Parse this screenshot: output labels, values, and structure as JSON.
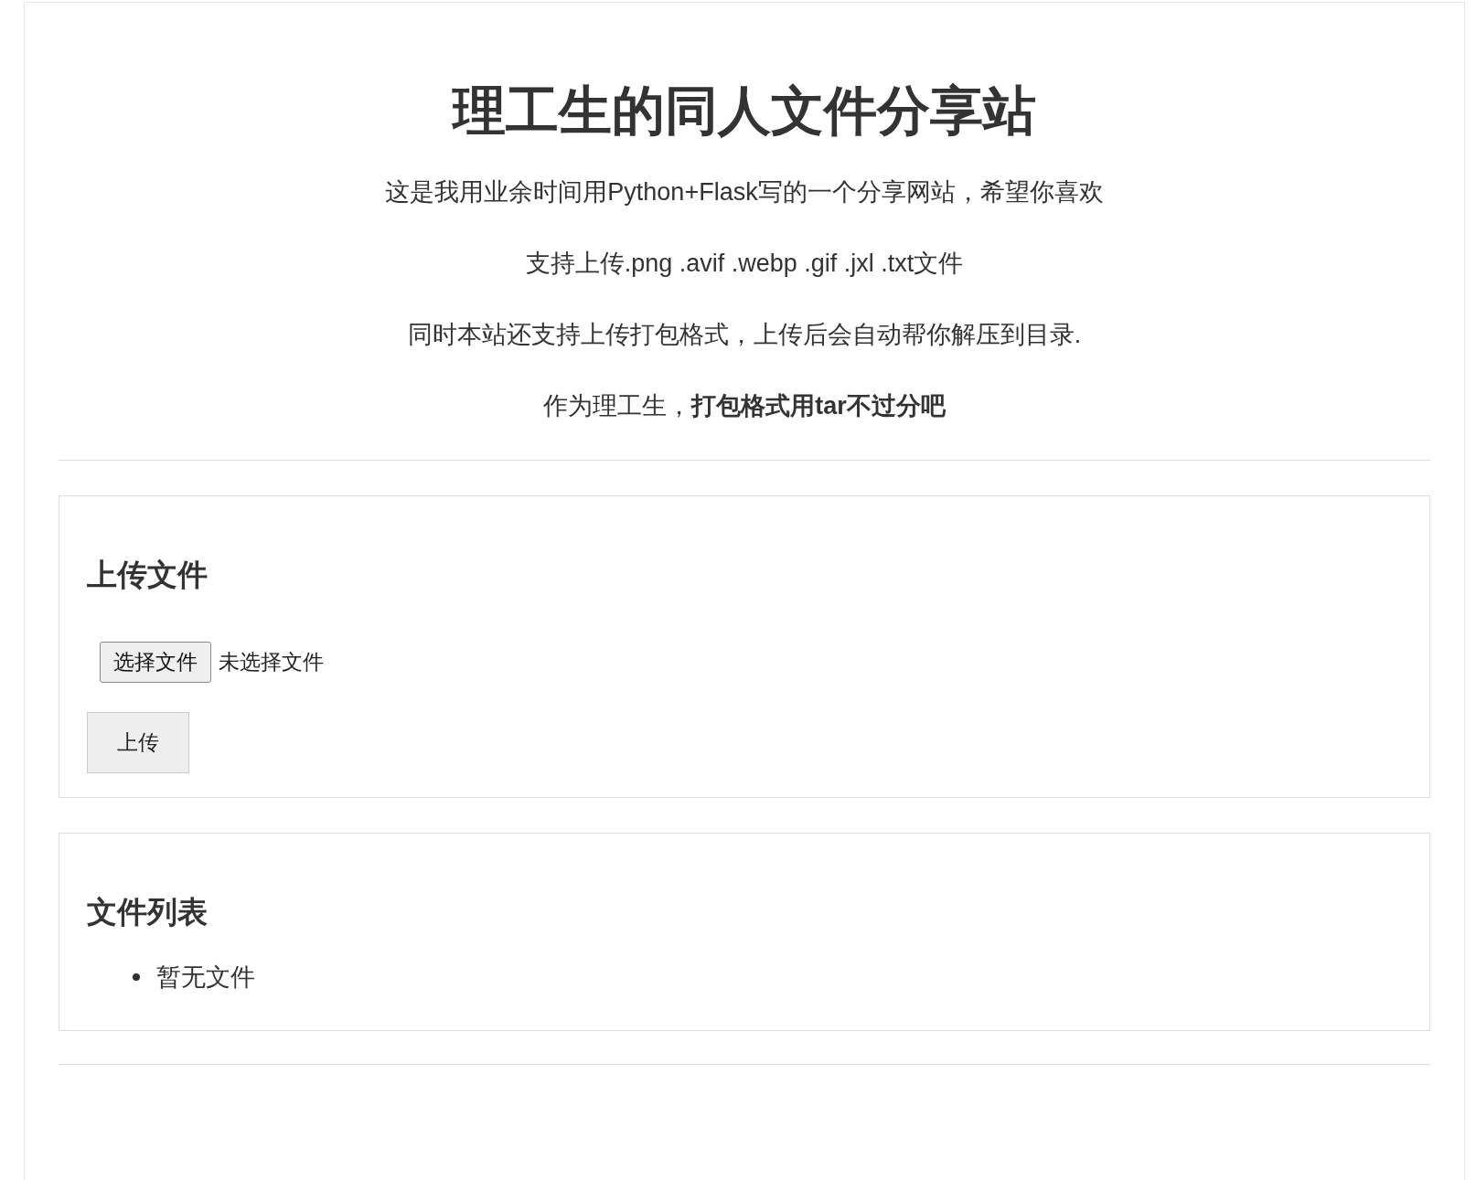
{
  "title": "理工生的同人文件分享站",
  "intro": [
    "这是我用业余时间用Python+Flask写的一个分享网站，希望你喜欢",
    "支持上传.png .avif .webp .gif .jxl .txt文件",
    "同时本站还支持上传打包格式，上传后会自动帮你解压到目录.",
    "作为理工生，**打包格式用tar不过分吧**"
  ],
  "upload": {
    "heading": "上传文件",
    "choose_button": "选择文件",
    "file_status": "未选择文件",
    "submit_button": "上传"
  },
  "files": {
    "heading": "文件列表",
    "items": [
      "暂无文件"
    ]
  }
}
